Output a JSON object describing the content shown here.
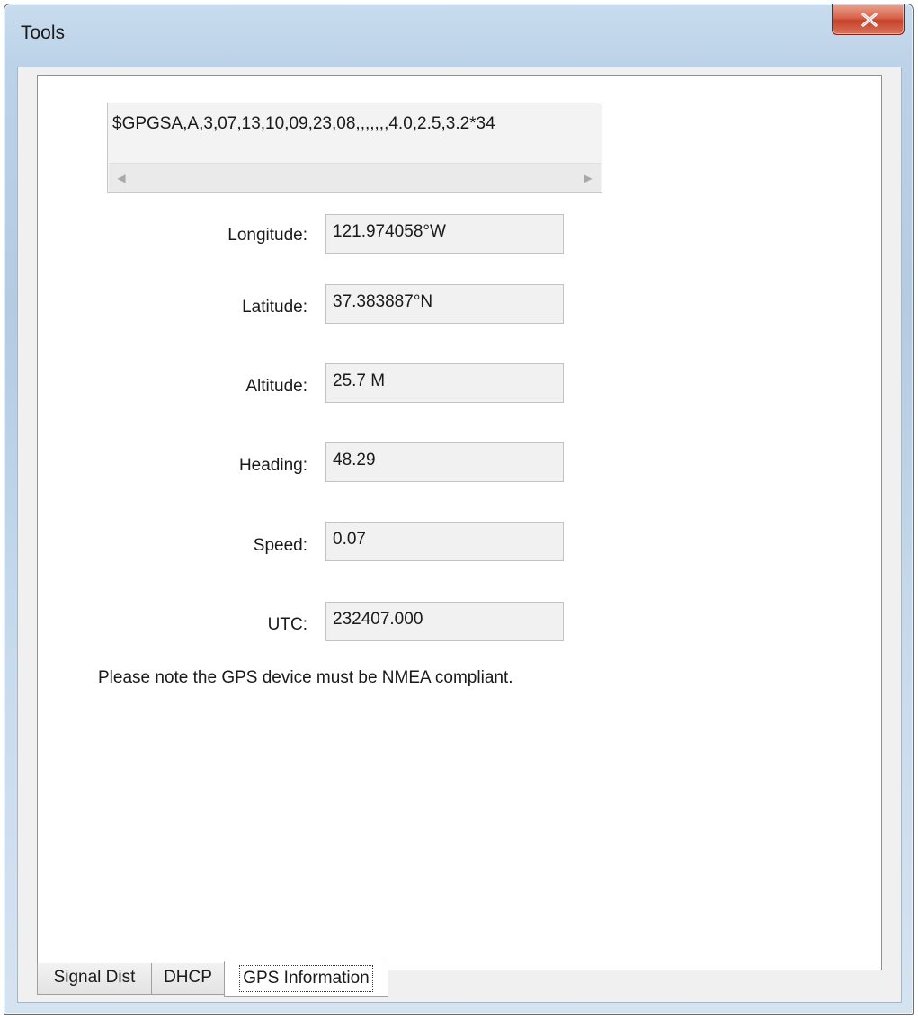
{
  "window": {
    "title": "Tools"
  },
  "nmea": {
    "sentence": "$GPGSA,A,3,07,13,10,09,23,08,,,,,,,4.0,2.5,3.2*34"
  },
  "fields": {
    "longitude": {
      "label": "Longitude:",
      "value": "121.974058°W"
    },
    "latitude": {
      "label": "Latitude:",
      "value": "37.383887°N"
    },
    "altitude": {
      "label": "Altitude:",
      "value": "25.7 M"
    },
    "heading": {
      "label": "Heading:",
      "value": "48.29"
    },
    "speed": {
      "label": "Speed:",
      "value": "0.07"
    },
    "utc": {
      "label": "UTC:",
      "value": "232407.000"
    }
  },
  "note": "Please note the GPS  device must be NMEA compliant.",
  "tabs": [
    {
      "label": "Signal Dist"
    },
    {
      "label": "DHCP"
    },
    {
      "label": "GPS Information",
      "active": true
    }
  ],
  "icons": {
    "close": "close-icon",
    "scroll_left": "scroll-left-icon",
    "scroll_right": "scroll-right-icon"
  },
  "colors": {
    "close_button": "#d24a32",
    "title_bar": "#bcd2e8",
    "panel_bg": "#ffffff"
  }
}
